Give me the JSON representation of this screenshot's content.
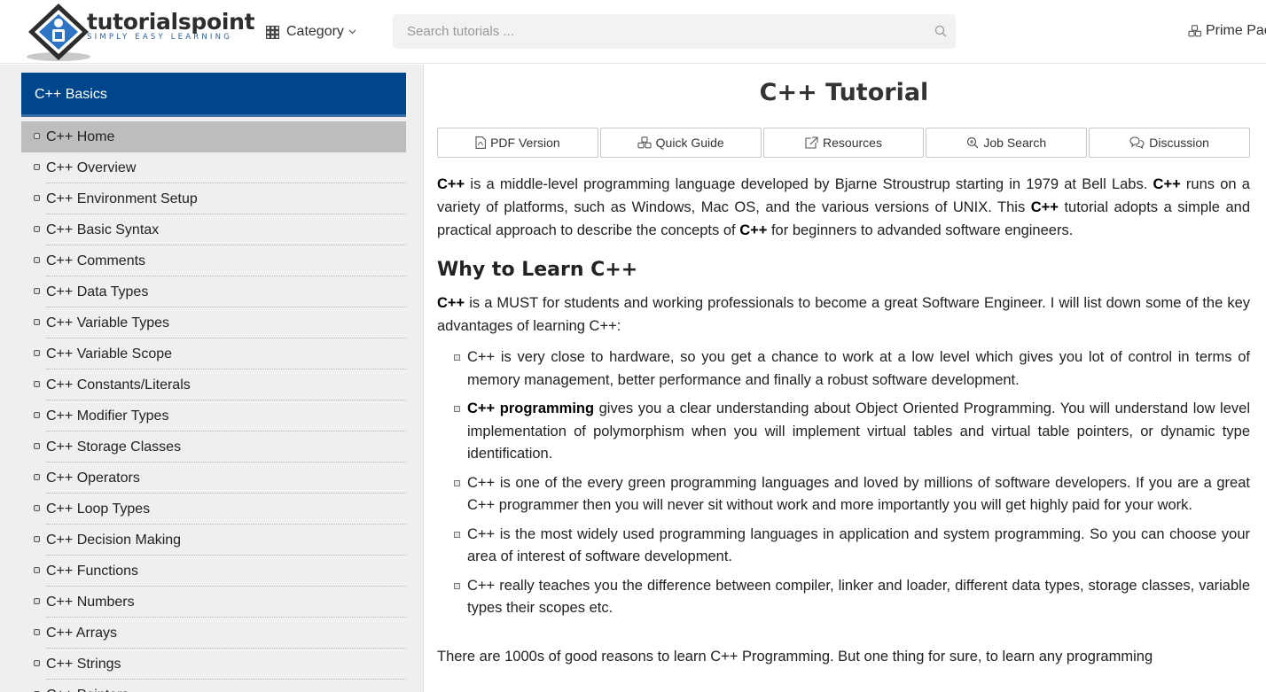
{
  "header": {
    "logo_name": "tutorialspoint",
    "logo_tagline": "SIMPLY EASY LEARNING",
    "category_label": "Category",
    "search_placeholder": "Search tutorials ...",
    "prime_label": "Prime Pac"
  },
  "sidebar": {
    "heading": "C++ Basics",
    "items": [
      "C++ Home",
      "C++ Overview",
      "C++ Environment Setup",
      "C++ Basic Syntax",
      "C++ Comments",
      "C++ Data Types",
      "C++ Variable Types",
      "C++ Variable Scope",
      "C++ Constants/Literals",
      "C++ Modifier Types",
      "C++ Storage Classes",
      "C++ Operators",
      "C++ Loop Types",
      "C++ Decision Making",
      "C++ Functions",
      "C++ Numbers",
      "C++ Arrays",
      "C++ Strings",
      "C++ Pointers"
    ],
    "active_index": 0
  },
  "main": {
    "title": "C++ Tutorial",
    "tabs": [
      {
        "label": "PDF Version",
        "icon": "pdf-icon"
      },
      {
        "label": "Quick Guide",
        "icon": "quick-guide-icon"
      },
      {
        "label": "Resources",
        "icon": "external-link-icon"
      },
      {
        "label": "Job Search",
        "icon": "search-icon"
      },
      {
        "label": "Discussion",
        "icon": "discussion-icon"
      }
    ],
    "intro": {
      "b1": "C++",
      "t1": " is a middle-level programming language developed by Bjarne Stroustrup starting in 1979 at Bell Labs. ",
      "b2": "C++",
      "t2": " runs on a variety of platforms, such as Windows, Mac OS, and the various versions of UNIX. This ",
      "b3": "C++",
      "t3": " tutorial adopts a simple and practical approach to describe the concepts of ",
      "b4": "C++",
      "t4": " for beginners to advanded software engineers."
    },
    "why_heading": "Why to Learn C++",
    "why_para": {
      "b1": "C++",
      "t1": " is a MUST for students and working professionals to become a great Software Engineer. I will list down some of the key advantages of learning C++:"
    },
    "bullets": [
      {
        "bold": "",
        "text": "C++ is very close to hardware, so you get a chance to work at a low level which gives you lot of control in terms of memory management, better performance and finally a robust software development."
      },
      {
        "bold": "C++ programming",
        "text": " gives you a clear understanding about Object Oriented Programming. You will understand low level implementation of polymorphism when you will implement virtual tables and virtual table pointers, or dynamic type identification."
      },
      {
        "bold": "",
        "text": "C++ is one of the every green programming languages and loved by millions of software developers. If you are a great C++ programmer then you will never sit without work and more importantly you will get highly paid for your work."
      },
      {
        "bold": "",
        "text": "C++ is the most widely used programming languages in application and system programming. So you can choose your area of interest of software development."
      },
      {
        "bold": "",
        "text": "C++ really teaches you the difference between compiler, linker and loader, different data types, storage classes, variable types their scopes etc."
      }
    ],
    "last_para": "There are 1000s of good reasons to learn C++ Programming. But one thing for sure, to learn any programming"
  },
  "colors": {
    "sidebar_heading_bg": "#00468c",
    "sidebar_active_bg": "#bdbdbd",
    "sidebar_bg": "#efefef"
  }
}
